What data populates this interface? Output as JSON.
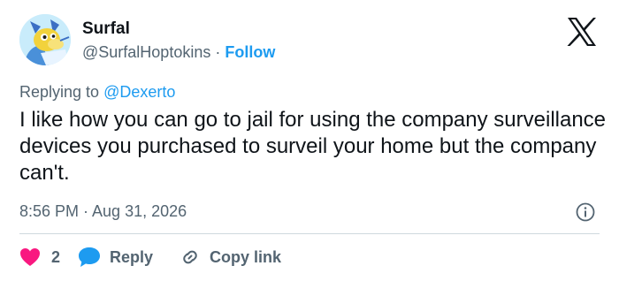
{
  "author": {
    "name": "Surfal",
    "handle": "@SurfalHoptokins",
    "separator": "·",
    "follow_label": "Follow"
  },
  "replying": {
    "prefix": "Replying to",
    "mention": "@Dexerto"
  },
  "tweet": {
    "text": "I like how you can go to jail for using the company surveillance devices you purchased to surveil your home but the company can't.",
    "timestamp": "8:56 PM · Aug 31, 2026"
  },
  "actions": {
    "like_count": "2",
    "reply_label": "Reply",
    "copy_label": "Copy link"
  },
  "icons": {
    "logo": "x-logo-icon",
    "info": "info-icon",
    "like": "heart-icon",
    "reply": "speech-bubble-icon",
    "copy": "link-icon"
  },
  "colors": {
    "link": "#1d9bf0",
    "like": "#f91880",
    "muted": "#536471",
    "text": "#0f1419"
  }
}
